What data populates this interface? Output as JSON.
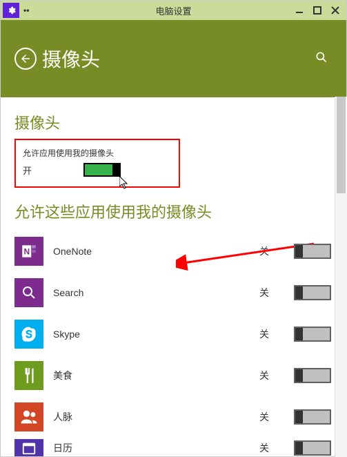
{
  "titlebar": {
    "title": "电脑设置"
  },
  "header": {
    "title": "摄像头"
  },
  "section1": {
    "title": "摄像头",
    "permission_label": "允许应用使用我的摄像头",
    "state": "开"
  },
  "section2": {
    "title": "允许这些应用使用我的摄像头"
  },
  "apps": [
    {
      "name": "OneNote",
      "state": "关"
    },
    {
      "name": "Search",
      "state": "关"
    },
    {
      "name": "Skype",
      "state": "关"
    },
    {
      "name": "美食",
      "state": "关"
    },
    {
      "name": "人脉",
      "state": "关"
    },
    {
      "name": "日历",
      "state": "关"
    }
  ]
}
